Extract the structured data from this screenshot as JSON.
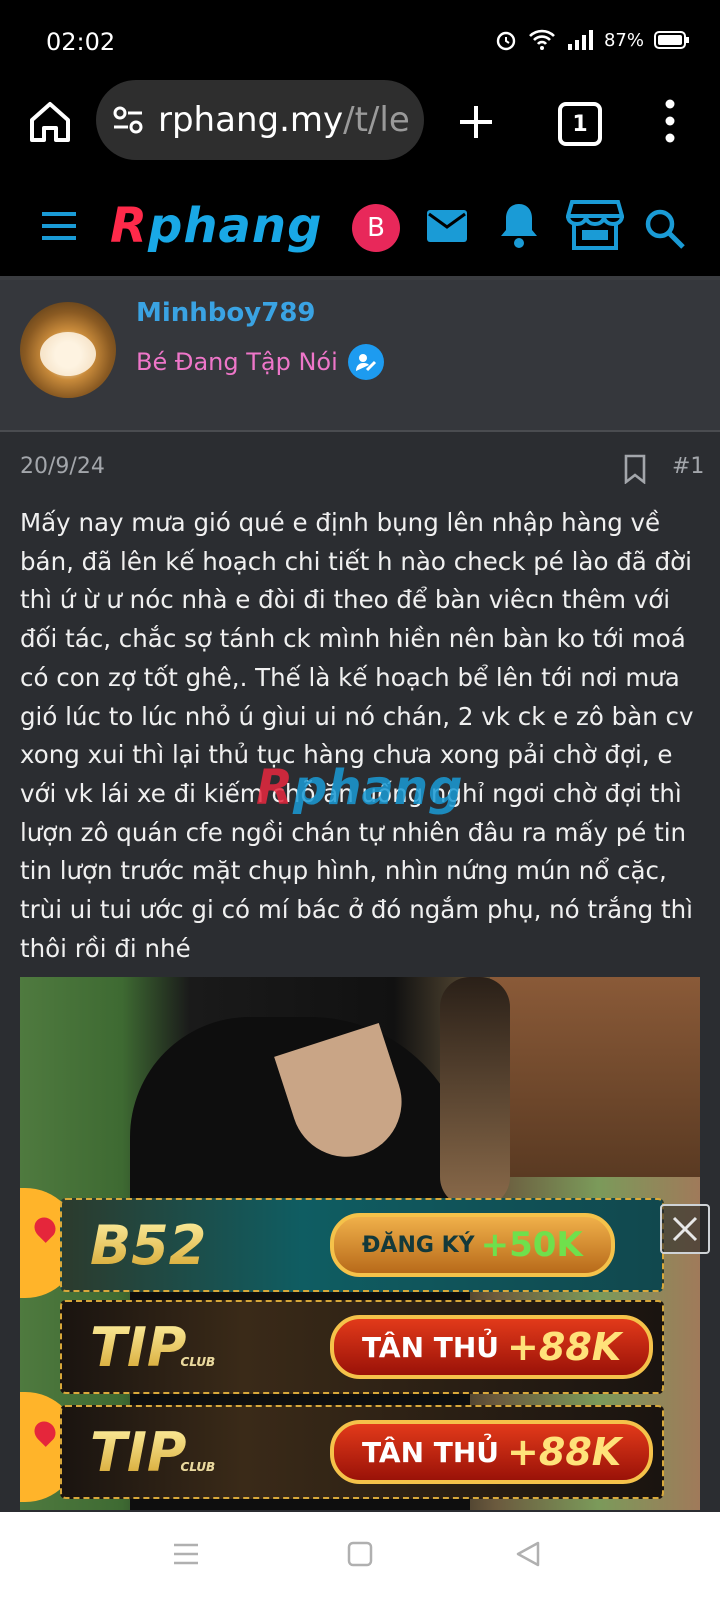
{
  "status_bar": {
    "time": "02:02",
    "battery": "87%"
  },
  "browser": {
    "url_host": "rphang.my",
    "url_path": "/t/le",
    "tab_count": "1"
  },
  "site": {
    "logo_first": "R",
    "logo_rest": "phang",
    "avatar_letter": "B"
  },
  "user": {
    "name": "Minhboy789",
    "title": "Bé Đang Tập Nói"
  },
  "post": {
    "date": "20/9/24",
    "number": "#1",
    "body": "Mấy nay mưa gió qué e định bụng lên nhập hàng về bán, đã lên kế hoạch chi tiết h nào check pé lào đã đời thì ứ ừ ư nóc nhà e đòi đi theo để bàn viêcn thêm với đối tác, chắc sợ tánh ck mình hiền nên bàn ko tới moá có con zợ tốt ghê,. Thế là kế hoạch bể lên tới nơi mưa gió lúc to lúc nhỏ ú gìui ui nó chán, 2 vk ck e zô bàn cv xong xui thì lại thủ tục hàng chưa xong pải chờ đợi, e với vk lái xe đi kiếm chỗ ăn uống nghỉ ngơi chờ đợi thì lượn zô quán cfe ngồi chán tự nhiên đâu ra mấy pé tin tin lượn trước mặt chụp hình, nhìn nứng mún nổ cặc, trùi ui tui ước gi có mí bác ở đó ngắm phụ, nó trắng thì thôi rồi đi nhé"
  },
  "watermark": {
    "first": "R",
    "rest": "phang"
  },
  "ads": [
    {
      "brand": "B52",
      "cta_text": "ĐĂNG KÝ",
      "cta_amount": "+50K"
    },
    {
      "brand": "TIP",
      "brand_sub": "CLUB",
      "cta_text": "TÂN THỦ",
      "cta_amount": "+88K"
    },
    {
      "brand": "TIP",
      "brand_sub": "CLUB",
      "cta_text": "TÂN THỦ",
      "cta_amount": "+88K"
    }
  ],
  "icons": [
    "home-icon",
    "site-settings-icon",
    "new-tab-icon",
    "tab-switcher-icon",
    "overflow-menu-icon",
    "hamburger-icon",
    "mail-icon",
    "bell-icon",
    "store-icon",
    "search-icon",
    "bookmark-icon",
    "close-icon",
    "recents-icon",
    "home-nav-icon",
    "back-icon"
  ],
  "colors": {
    "accent": "#3aa3e3",
    "user_title": "#ee76c9",
    "avatar_bg": "#e8285a"
  }
}
